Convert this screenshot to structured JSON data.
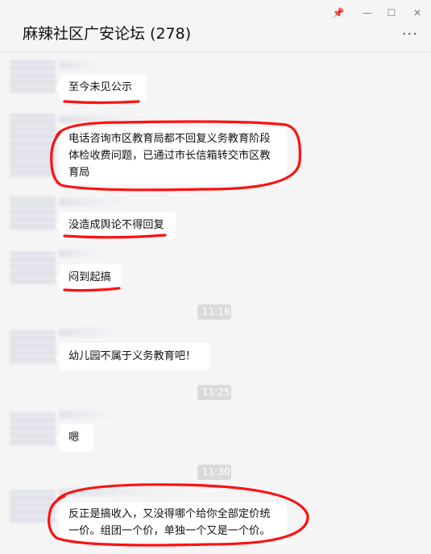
{
  "window": {
    "title": "麻辣社区广安论坛 (278)",
    "controls": {
      "pin": "📌",
      "minimize": "—",
      "maximize": "☐",
      "close": "✕"
    },
    "more_label": "···"
  },
  "messages": [
    {
      "text": "至今未见公示"
    },
    {
      "text": "电话咨询市区教育局都不回复义务教育阶段体检收费问题，已通过市长信箱转交市区教育局"
    },
    {
      "text": "没造成舆论不得回复"
    },
    {
      "text": "闷到起搞"
    },
    {
      "text": "幼儿园不属于义务教育吧！"
    },
    {
      "text": "嗯"
    },
    {
      "text": "反正是搞收入，又没得哪个给你全部定价统一价。组团一个价，单独一个又是一个价。"
    }
  ],
  "timestamps": [
    "11:16",
    "11:25",
    "11:30"
  ],
  "annotation_color": "#ff1010"
}
